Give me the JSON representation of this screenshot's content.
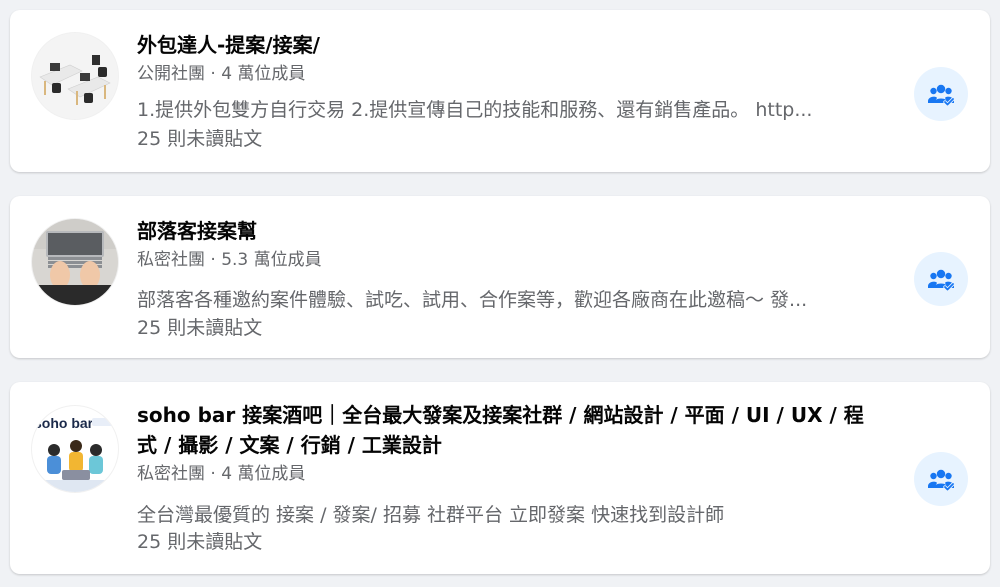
{
  "groups": [
    {
      "name": "外包達人-提案/接案/",
      "meta": "公開社團 · 4 萬位成員",
      "description": "1.提供外包雙方自行交易 2.提供宣傳自己的技能和服務、還有銷售產品。 http...",
      "unread": "25 則未讀貼文",
      "button_icon": "group-joined-icon"
    },
    {
      "name": "部落客接案幫",
      "meta": "私密社團 · 5.3 萬位成員",
      "description": "部落客各種邀約案件體驗、試吃、試用、合作案等，歡迎各廠商在此邀稿～ 發...",
      "unread": "25 則未讀貼文",
      "button_icon": "group-joined-icon"
    },
    {
      "name": "soho bar 接案酒吧｜全台最大發案及接案社群 / 網站設計 / 平面 / UI / UX / 程式 / 攝影 / 文案 / 行銷 / 工業設計",
      "meta": "私密社團 · 4 萬位成員",
      "description": "全台灣最優質的 接案 / 發案/ 招募 社群平台 立即發案 快速找到設計師",
      "unread": "25 則未讀貼文",
      "avatar_logo_text": "soho bar",
      "button_icon": "group-joined-icon"
    }
  ],
  "colors": {
    "accent": "#1877f2",
    "button_bg": "#e7f3ff",
    "secondary_text": "#65676b",
    "page_bg": "#f0f2f5"
  }
}
